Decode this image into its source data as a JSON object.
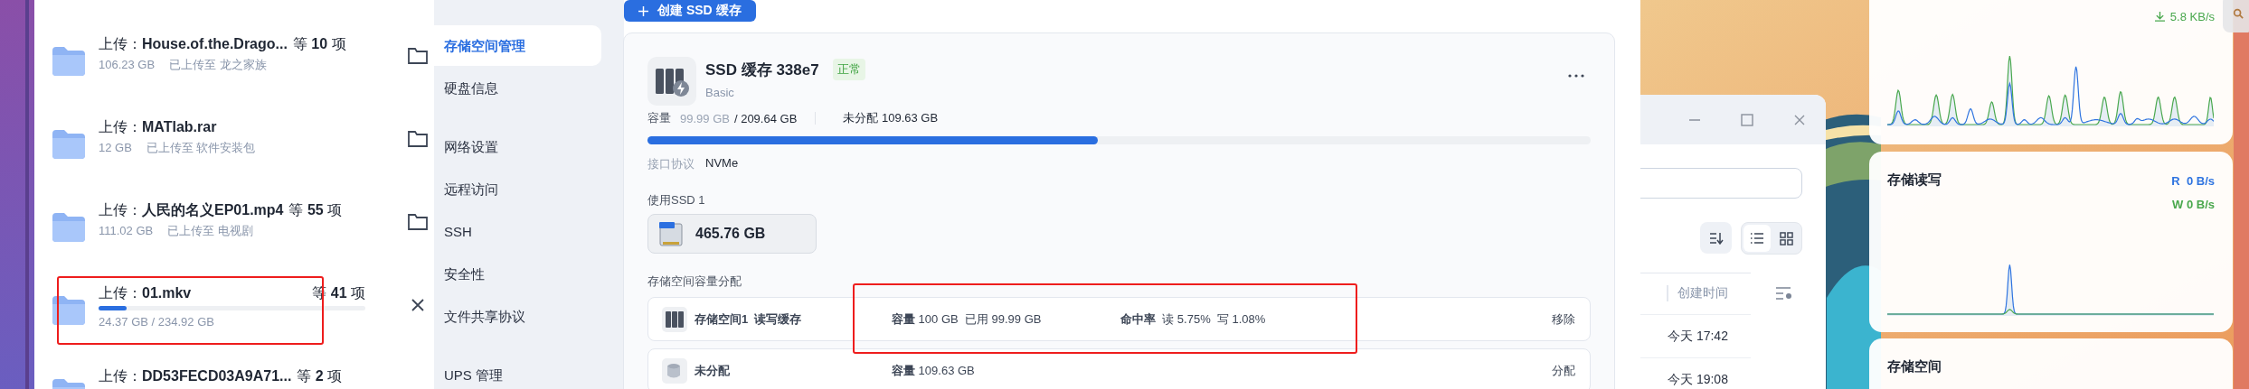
{
  "upload_panel": {
    "items": [
      {
        "kind": "done",
        "title": "上传：**House.of.the.Drago...**",
        "count": "等 **10** 项",
        "size": "106.23 GB",
        "destination": "已上传至 龙之家族"
      },
      {
        "kind": "done",
        "title": "上传：**MATlab.rar**",
        "size": "12 GB",
        "destination": "已上传至 软件安装包"
      },
      {
        "kind": "done",
        "title": "上传：**人民的名义EP01.mp4**",
        "count": "等 **55** 项",
        "size": "111.02 GB",
        "destination": "已上传至 电视剧"
      },
      {
        "kind": "uploading",
        "title": "上传：**01.mkv**",
        "count": "等 **41** 项",
        "level": 0.104,
        "progress": "24.37 GB / 234.92 GB"
      },
      {
        "kind": "done",
        "title": "上传：**DD53FECD03A9A71...**",
        "count": "等 **2** 项"
      }
    ]
  },
  "sidebar": {
    "groups": [
      {
        "items": [
          {
            "label": "存储空间管理",
            "selected": true
          },
          {
            "label": "硬盘信息",
            "selected": false
          }
        ]
      },
      {
        "items": [
          {
            "label": "网络设置",
            "selected": false
          },
          {
            "label": "远程访问",
            "selected": false
          },
          {
            "label": "SSH",
            "selected": false
          },
          {
            "label": "安全性",
            "selected": false
          },
          {
            "label": "文件共享协议",
            "selected": false
          }
        ]
      },
      {
        "items": [
          {
            "label": "UPS 管理",
            "selected": false
          }
        ]
      }
    ]
  },
  "create_button": {
    "label": "创建 SSD 缓存"
  },
  "cache": {
    "title": "SSD 缓存 338e7",
    "status": "正常",
    "type": "Basic",
    "capacity_label": "容量",
    "used": "99.99 GB",
    "total": "/ 209.64 GB",
    "unallocated": "未分配 109.63 GB",
    "level": 0.477,
    "interface_label": "接口协议",
    "interface": "NVMe",
    "ssd_label": "使用SSD 1",
    "ssd_size": "465.76 GB",
    "allocation_label": "存储空间容量分配",
    "allocations": [
      {
        "kind": "volume",
        "name": "存储空间1  读写缓存",
        "capacity": "**容量** 100 GB  已用 99.99 GB",
        "hit_rate": "**命中率**  读 5.75%  写 1.08%",
        "action": "移除"
      },
      {
        "kind": "unallocated",
        "name": "未分配",
        "capacity": "**容量** 109.63 GB",
        "action": "分配"
      }
    ]
  },
  "file_window": {
    "view_modes": [
      {
        "kind": "list",
        "selected": true
      },
      {
        "kind": "grid",
        "selected": false
      }
    ],
    "column": "创建时间",
    "rows": [
      "今天 17:42",
      "今天 19:08"
    ]
  },
  "widgets": {
    "network": {
      "download": "5.8 KB/s"
    },
    "disk_io": {
      "title": "存储读写",
      "read_label": "R",
      "read": "0 B/s",
      "write_label": "W",
      "write": "0 B/s"
    },
    "storage": {
      "title": "存储空间"
    }
  }
}
